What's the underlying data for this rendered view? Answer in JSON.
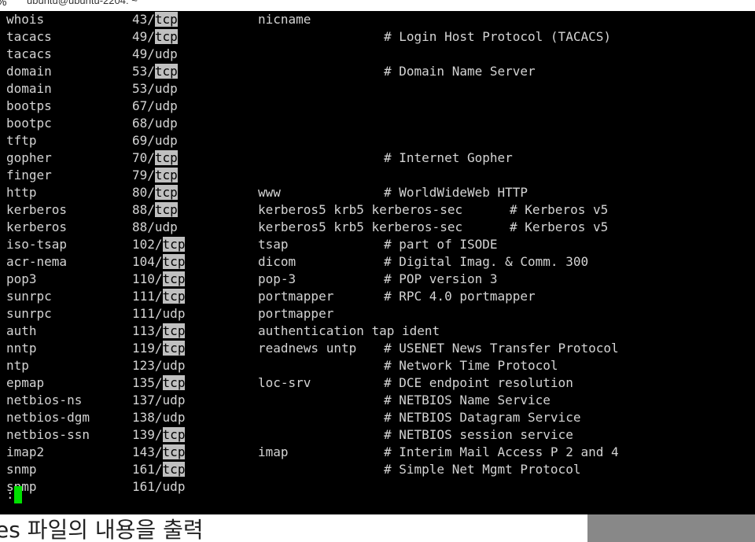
{
  "window": {
    "title": "ubuntu@ubuntu-2204: ~",
    "corner_glyph": "%"
  },
  "entries": [
    {
      "name": "whois",
      "port": "43",
      "proto": "tcp",
      "alias": "nicname",
      "comment": ""
    },
    {
      "name": "tacacs",
      "port": "49",
      "proto": "tcp",
      "alias": "",
      "comment": "# Login Host Protocol (TACACS)"
    },
    {
      "name": "tacacs",
      "port": "49",
      "proto": "udp",
      "alias": "",
      "comment": ""
    },
    {
      "name": "domain",
      "port": "53",
      "proto": "tcp",
      "alias": "",
      "comment": "# Domain Name Server"
    },
    {
      "name": "domain",
      "port": "53",
      "proto": "udp",
      "alias": "",
      "comment": ""
    },
    {
      "name": "bootps",
      "port": "67",
      "proto": "udp",
      "alias": "",
      "comment": ""
    },
    {
      "name": "bootpc",
      "port": "68",
      "proto": "udp",
      "alias": "",
      "comment": ""
    },
    {
      "name": "tftp",
      "port": "69",
      "proto": "udp",
      "alias": "",
      "comment": ""
    },
    {
      "name": "gopher",
      "port": "70",
      "proto": "tcp",
      "alias": "",
      "comment": "# Internet Gopher"
    },
    {
      "name": "finger",
      "port": "79",
      "proto": "tcp",
      "alias": "",
      "comment": ""
    },
    {
      "name": "http",
      "port": "80",
      "proto": "tcp",
      "alias": "www",
      "comment": "# WorldWideWeb HTTP"
    },
    {
      "name": "kerberos",
      "port": "88",
      "proto": "tcp",
      "alias": "kerberos5 krb5 kerberos-sec",
      "comment": "# Kerberos v5",
      "wide": true
    },
    {
      "name": "kerberos",
      "port": "88",
      "proto": "udp",
      "alias": "kerberos5 krb5 kerberos-sec",
      "comment": "# Kerberos v5",
      "wide": true
    },
    {
      "name": "iso-tsap",
      "port": "102",
      "proto": "tcp",
      "alias": "tsap",
      "comment": "# part of ISODE"
    },
    {
      "name": "acr-nema",
      "port": "104",
      "proto": "tcp",
      "alias": "dicom",
      "comment": "# Digital Imag. & Comm. 300"
    },
    {
      "name": "pop3",
      "port": "110",
      "proto": "tcp",
      "alias": "pop-3",
      "comment": "# POP version 3"
    },
    {
      "name": "sunrpc",
      "port": "111",
      "proto": "tcp",
      "alias": "portmapper",
      "comment": "# RPC 4.0 portmapper"
    },
    {
      "name": "sunrpc",
      "port": "111",
      "proto": "udp",
      "alias": "portmapper",
      "comment": ""
    },
    {
      "name": "auth",
      "port": "113",
      "proto": "tcp",
      "alias": "authentication tap ident",
      "comment": ""
    },
    {
      "name": "nntp",
      "port": "119",
      "proto": "tcp",
      "alias": "readnews untp",
      "comment": "# USENET News Transfer Protocol"
    },
    {
      "name": "ntp",
      "port": "123",
      "proto": "udp",
      "alias": "",
      "comment": "# Network Time Protocol"
    },
    {
      "name": "epmap",
      "port": "135",
      "proto": "tcp",
      "alias": "loc-srv",
      "comment": "# DCE endpoint resolution"
    },
    {
      "name": "netbios-ns",
      "port": "137",
      "proto": "udp",
      "alias": "",
      "comment": "# NETBIOS Name Service"
    },
    {
      "name": "netbios-dgm",
      "port": "138",
      "proto": "udp",
      "alias": "",
      "comment": "# NETBIOS Datagram Service"
    },
    {
      "name": "netbios-ssn",
      "port": "139",
      "proto": "tcp",
      "alias": "",
      "comment": "# NETBIOS session service"
    },
    {
      "name": "imap2",
      "port": "143",
      "proto": "tcp",
      "alias": "imap",
      "comment": "# Interim Mail Access P 2 and 4"
    },
    {
      "name": "snmp",
      "port": "161",
      "proto": "tcp",
      "alias": "",
      "comment": "# Simple Net Mgmt Protocol"
    },
    {
      "name": "snmp",
      "port": "161",
      "proto": "udp",
      "alias": "",
      "comment": ""
    }
  ],
  "search_highlight": "tcp",
  "prompt": ":",
  "below_text": "es 파일의 내용을 출력",
  "colors": {
    "terminal_bg": "#000000",
    "terminal_fg": "#d4d4d4",
    "highlight_bg": "#c0c0c0",
    "cursor": "#00e000"
  }
}
